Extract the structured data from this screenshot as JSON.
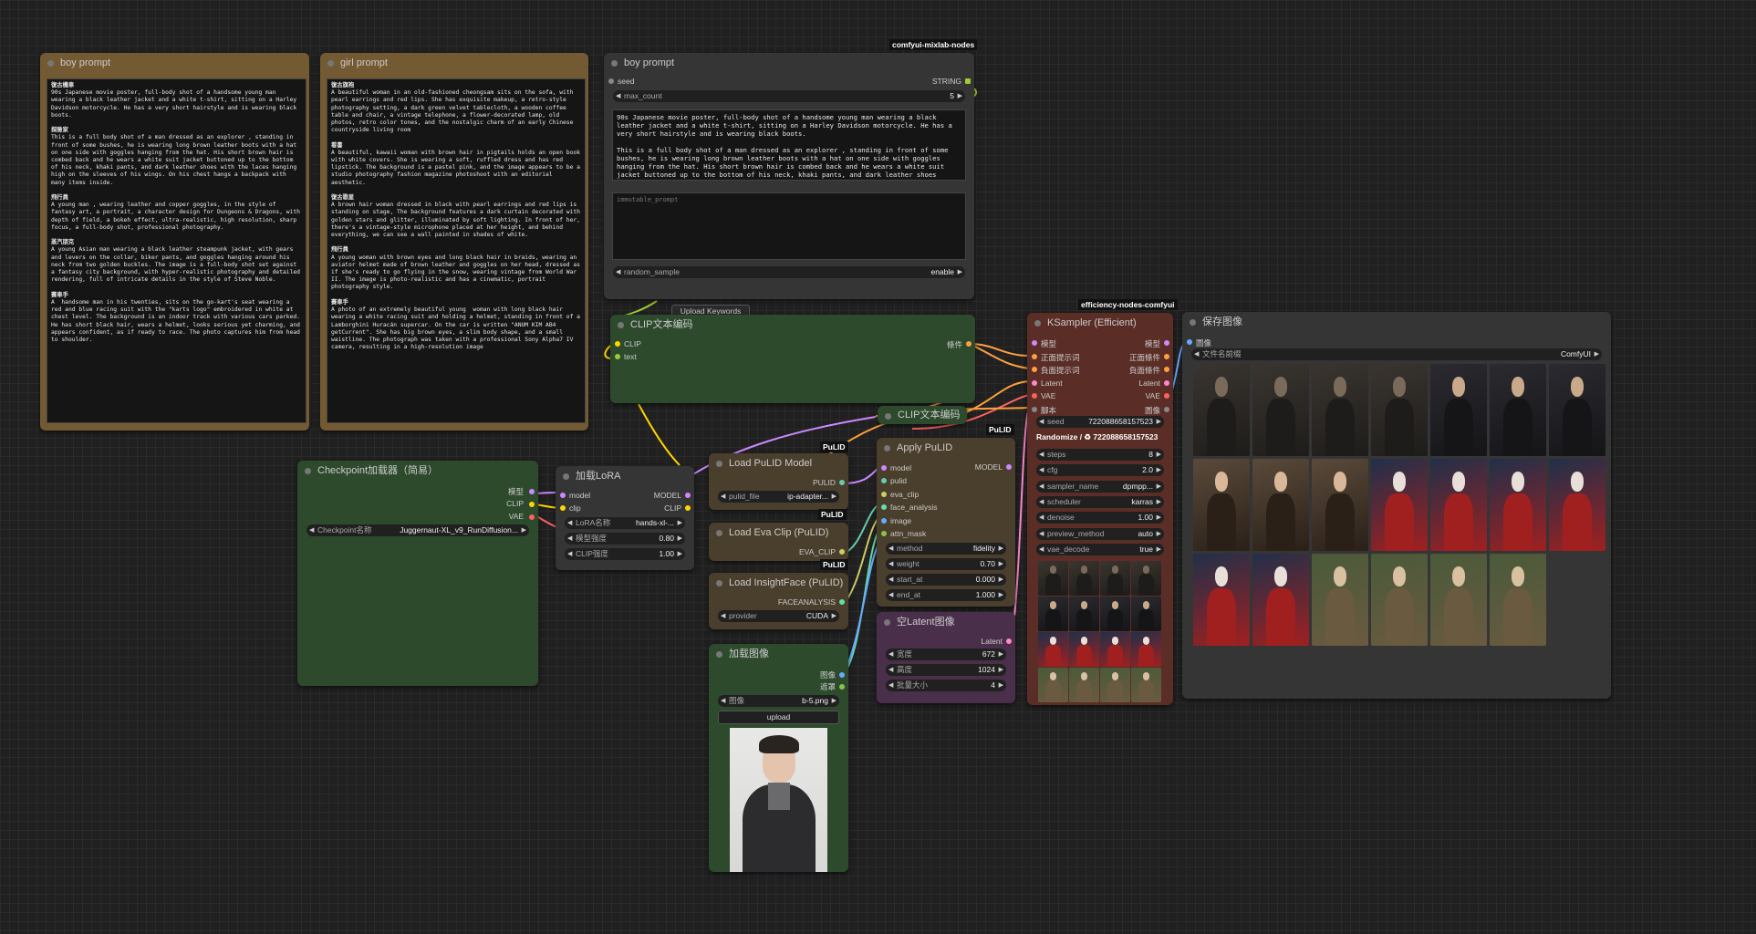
{
  "boy1": {
    "title": "boy prompt",
    "sections": [
      {
        "h": "復古機車",
        "t": "90s Japanese movie poster, full-body shot of a handsome young man wearing a black leather jacket and a white t-shirt, sitting on a Harley Davidson motorcycle. He has a very short hairstyle and is wearing black boots."
      },
      {
        "h": "探險家",
        "t": "This is a full body shot of a man dressed as an explorer , standing in front of some bushes, he is wearing long brown leather boots with a hat on one side with goggles hanging from the hat. His short brown hair is combed back and he wears a white suit jacket buttoned up to the bottom of his neck, khaki pants, and dark leather shoes with the laces hanging high on the sleeves of his wings. On his chest hangs a backpack with many items inside."
      },
      {
        "h": "飛行員",
        "t": "A young man , wearing leather and copper goggles, in the style of fantasy art, a portrait, a character design for Dungeons & Dragons, with depth of field, a bokeh effect, ultra-realistic, high resolution, sharp focus, a full-body shot, professional photography."
      },
      {
        "h": "蒸汽朋克",
        "t": "A young Asian man wearing a black leather steampunk jacket, with gears and levers on the collar, biker pants, and goggles hanging around his neck from two golden buckles. The image is a full-body shot set against a fantasy city background, with hyper-realistic photography and detailed rendering, full of intricate details in the style of Steve Noble."
      },
      {
        "h": "賽車手",
        "t": "A  handsome man in his twenties, sits on the go-kart's seat wearing a red and blue racing suit with the \"karts logo\" embroidered in white at chest level. The background is an indoor track with various cars parked. He has short black hair, wears a helmet, looks serious yet charming, and appears confident, as if ready to race. The photo captures him from head to shoulder."
      }
    ]
  },
  "girl": {
    "title": "girl prompt",
    "sections": [
      {
        "h": "復古旗袍",
        "t": "A beautiful woman in an old-fashioned cheongsam sits on the sofa, with pearl earrings and red lips. She has exquisite makeup, a retro-style photography setting, a dark green velvet tablecloth, a wooden coffee table and chair, a vintage telephone, a flower-decorated lamp, old photos, retro color tones, and the nostalgic charm of an early Chinese countryside living room"
      },
      {
        "h": "看書",
        "t": "A beautiful, kawaii woman with brown hair in pigtails holds an open book with white covers. She is wearing a soft, ruffled dress and has red lipstick. The background is a pastel pink, and the image appears to be a studio photography fashion magazine photoshoot with an editorial aesthetic."
      },
      {
        "h": "復古歌星",
        "t": "A brown hair woman dressed in black with pearl earrings and red lips is standing on stage, The background features a dark curtain decorated with golden stars and glitter, illuminated by soft lighting. In front of her, there's a vintage-style microphone placed at her height, and behind everything, we can see a wall painted in shades of white."
      },
      {
        "h": "飛行員",
        "t": "A young woman with brown eyes and long black hair in braids, wearing an aviator helmet made of brown leather and goggles on her head, dressed as if she's ready to go flying in the snow, wearing vintage from World War II. The image is photo-realistic and has a cinematic, portrait photography style."
      },
      {
        "h": "賽車手",
        "t": "A photo of an extremely beautiful young  woman with long black hair wearing a white racing suit and holding a helmet, standing in front of a Lamborghini Huracán supercar. On the car is written \"ANUM KIM AB4  getCurrent\". She has big brown eyes, a slim body shape, and a small waistline. The photograph was taken with a professional Sony Alpha7 IV camera, resulting in a high-resolution image"
      }
    ]
  },
  "boy2": {
    "title": "boy prompt",
    "tag": "comfyui-mixlab-nodes",
    "seed_label": "seed",
    "seed_type": "STRING",
    "max_count_label": "max_count",
    "max_count": "5",
    "text1": "90s Japanese movie poster, full-body shot of a handsome young man wearing a black leather jacket and a white t-shirt, sitting on a Harley Davidson motorcycle. He has a very short hairstyle and is wearing black boots.",
    "text2": "This is a full body shot of a man dressed as an explorer , standing in front of some bushes, he is wearing long brown leather boots with a hat on one side with goggles hanging from the hat. His short brown hair is combed back and he wears a white suit jacket buttoned up to the bottom of his neck, khaki pants, and dark leather shoes",
    "immutable_placeholder": "immutable_prompt",
    "random_label": "random_sample",
    "random_value": "enable"
  },
  "upload_keywords": "Upload Keywords",
  "clip_encode": {
    "title": "CLIP文本编码",
    "in1": "CLIP",
    "in2": "text",
    "out": "條件"
  },
  "clip_encode2": {
    "title": "CLIP文本编码"
  },
  "checkpoint": {
    "title": "Checkpoint加载器（简易）",
    "out1": "模型",
    "out2": "CLIP",
    "out3": "VAE",
    "w_label": "Checkpoint名称",
    "w_value": "Juggernaut-XL_v9_RunDiffusion..."
  },
  "lora": {
    "title": "加载LoRA",
    "in1": "model",
    "in2": "clip",
    "out1": "MODEL",
    "out2": "CLIP",
    "w1l": "LoRA名称",
    "w1v": "hands-xl-...",
    "w2l": "模型强度",
    "w2v": "0.80",
    "w3l": "CLIP强度",
    "w3v": "1.00"
  },
  "pulid_loader": {
    "title": "Load PuLID Model",
    "tag": "PuLID",
    "out": "PULID",
    "w_label": "pulid_file",
    "w_value": "ip-adapter..."
  },
  "eva_clip": {
    "title": "Load Eva Clip (PuLID)",
    "tag": "PuLID",
    "out": "EVA_CLIP"
  },
  "insightface": {
    "title": "Load InsightFace (PuLID)",
    "tag": "PuLID",
    "out": "FACEANALYSIS",
    "w_label": "provider",
    "w_value": "CUDA"
  },
  "load_image": {
    "title": "加载图像",
    "out1": "图像",
    "out2": "遮罩",
    "w_label": "图像",
    "w_value": "b-5.png",
    "upload": "upload"
  },
  "apply_pulid": {
    "title": "Apply PuLID",
    "tag": "PuLID",
    "inputs": [
      "model",
      "pulid",
      "eva_clip",
      "face_analysis",
      "image",
      "attn_mask"
    ],
    "out": "MODEL",
    "widgets": [
      {
        "l": "method",
        "v": "fidelity"
      },
      {
        "l": "weight",
        "v": "0.70"
      },
      {
        "l": "start_at",
        "v": "0.000"
      },
      {
        "l": "end_at",
        "v": "1.000"
      }
    ]
  },
  "empty_latent": {
    "title": "空Latent图像",
    "out": "Latent",
    "widgets": [
      {
        "l": "宽度",
        "v": "672"
      },
      {
        "l": "高度",
        "v": "1024"
      },
      {
        "l": "批量大小",
        "v": "4"
      }
    ]
  },
  "ksampler": {
    "title": "KSampler (Efficient)",
    "tag": "efficiency-nodes-comfyui",
    "ports": [
      {
        "in": "模型",
        "out": "模型"
      },
      {
        "in": "正面提示词",
        "out": "正面條件"
      },
      {
        "in": "負面提示词",
        "out": "負面條件"
      },
      {
        "in": "Latent",
        "out": "Latent"
      },
      {
        "in": "VAE",
        "out": "VAE"
      },
      {
        "in": "腳本",
        "out": "圖像"
      }
    ],
    "seed_label": "seed",
    "seed_value": "722088658157523",
    "randomize": "Randomize / ♻ 722088658157523",
    "widgets": [
      {
        "l": "steps",
        "v": "8"
      },
      {
        "l": "cfg",
        "v": "2.0"
      },
      {
        "l": "sampler_name",
        "v": "dpmpp..."
      },
      {
        "l": "scheduler",
        "v": "karras"
      },
      {
        "l": "denoise",
        "v": "1.00"
      },
      {
        "l": "preview_method",
        "v": "auto"
      },
      {
        "l": "vae_decode",
        "v": "true"
      }
    ]
  },
  "save_image": {
    "title": "保存图像",
    "in": "圖像",
    "w_label": "文件名前缀",
    "w_value": "ComfyUI"
  },
  "colors": {
    "bg": "#202020",
    "note": "#735a32",
    "green": "#2d4a2d",
    "pulid": "#4a3e2c",
    "latent": "#4a2f4a",
    "ksampler": "#5a2e26",
    "save": "#353535"
  }
}
